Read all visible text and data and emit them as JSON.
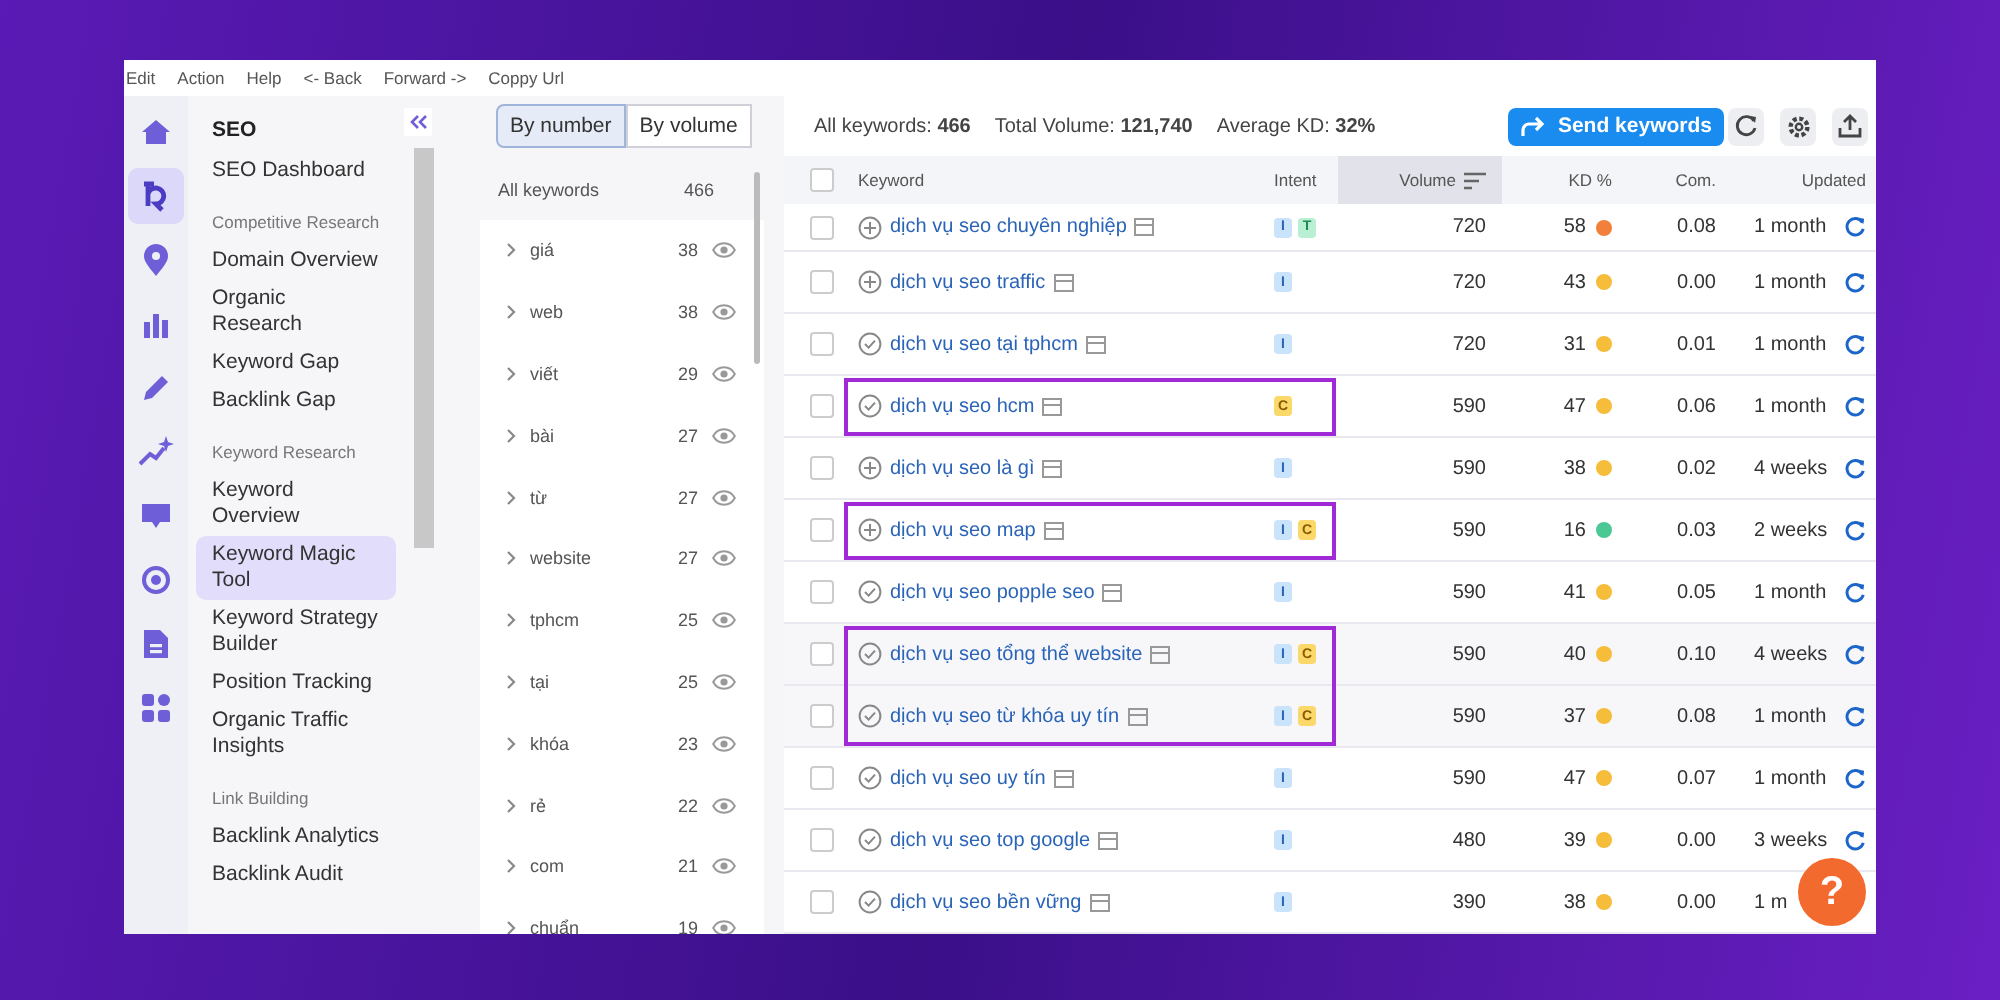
{
  "menu_bar": [
    "Edit",
    "Action",
    "Help",
    "<- Back",
    "Forward ->",
    "Coppy Url"
  ],
  "nav_rail": [
    {
      "selected": false
    },
    {
      "selected": true
    },
    {
      "selected": false
    },
    {
      "selected": false
    },
    {
      "selected": false
    },
    {
      "selected": false
    },
    {
      "selected": false
    },
    {
      "selected": false
    },
    {
      "selected": false
    },
    {
      "selected": false
    }
  ],
  "sidebar": {
    "title": "SEO",
    "items": [
      {
        "kind": "item",
        "label": "SEO Dashboard",
        "selected": false
      },
      {
        "kind": "section",
        "label": "Competitive Research"
      },
      {
        "kind": "item",
        "label": "Domain Overview",
        "selected": false
      },
      {
        "kind": "item",
        "label": "Organic Research",
        "selected": false
      },
      {
        "kind": "item",
        "label": "Keyword Gap",
        "selected": false
      },
      {
        "kind": "item",
        "label": "Backlink Gap",
        "selected": false
      },
      {
        "kind": "section",
        "label": "Keyword Research"
      },
      {
        "kind": "item",
        "label": "Keyword Overview",
        "selected": false
      },
      {
        "kind": "item",
        "label": "Keyword Magic Tool",
        "selected": true
      },
      {
        "kind": "item",
        "label": "Keyword Strategy Builder",
        "selected": false
      },
      {
        "kind": "item",
        "label": "Position Tracking",
        "selected": false
      },
      {
        "kind": "item",
        "label": "Organic Traffic Insights",
        "selected": false
      },
      {
        "kind": "section",
        "label": "Link Building"
      },
      {
        "kind": "item",
        "label": "Backlink Analytics",
        "selected": false
      },
      {
        "kind": "item",
        "label": "Backlink Audit",
        "selected": false
      }
    ]
  },
  "group_tabs": [
    {
      "label": "By number",
      "selected": true
    },
    {
      "label": "By volume",
      "selected": false
    }
  ],
  "groups": {
    "all_label": "All keywords",
    "all_count": "466",
    "items": [
      {
        "label": "giá",
        "count": "38"
      },
      {
        "label": "web",
        "count": "38"
      },
      {
        "label": "viết",
        "count": "29"
      },
      {
        "label": "bài",
        "count": "27"
      },
      {
        "label": "từ",
        "count": "27"
      },
      {
        "label": "website",
        "count": "27"
      },
      {
        "label": "tphcm",
        "count": "25"
      },
      {
        "label": "tại",
        "count": "25"
      },
      {
        "label": "khóa",
        "count": "23"
      },
      {
        "label": "rẻ",
        "count": "22"
      },
      {
        "label": "com",
        "count": "21"
      },
      {
        "label": "chuẩn",
        "count": "19"
      }
    ]
  },
  "summary": {
    "all_label": "All keywords:",
    "all_value": "466",
    "volume_label": "Total Volume:",
    "volume_value": "121,740",
    "kd_label": "Average KD:",
    "kd_value": "32%"
  },
  "send_button": "Send keywords",
  "table": {
    "select_all_checked": false,
    "columns": [
      "Keyword",
      "Intent",
      "Volume",
      "KD %",
      "Com.",
      "Updated"
    ],
    "rows": [
      {
        "keyword": "dịch vụ seo chuyên nghiệp",
        "checked": false,
        "added": false,
        "intent": [
          {
            "label": "I",
            "kind": "informational"
          },
          {
            "label": "T",
            "kind": "transactional"
          }
        ],
        "volume": "720",
        "kd": "58",
        "color": "#f2803a",
        "com": "0.08",
        "updated": "1 month",
        "highlighted": false
      },
      {
        "keyword": "dịch vụ seo traffic",
        "checked": false,
        "added": false,
        "intent": [
          {
            "label": "I",
            "kind": "informational"
          }
        ],
        "volume": "720",
        "kd": "43",
        "color": "#f5bd3a",
        "com": "0.00",
        "updated": "1 month",
        "highlighted": false
      },
      {
        "keyword": "dịch vụ seo tại tphcm",
        "checked": false,
        "added": true,
        "intent": [
          {
            "label": "I",
            "kind": "informational"
          }
        ],
        "volume": "720",
        "kd": "31",
        "color": "#f5bd3a",
        "com": "0.01",
        "updated": "1 month",
        "highlighted": false
      },
      {
        "keyword": "dịch vụ seo hcm",
        "checked": false,
        "added": true,
        "intent": [
          {
            "label": "C",
            "kind": "commercial"
          }
        ],
        "volume": "590",
        "kd": "47",
        "color": "#f5bd3a",
        "com": "0.06",
        "updated": "1 month",
        "highlighted": true
      },
      {
        "keyword": "dịch vụ seo là gì",
        "checked": false,
        "added": false,
        "intent": [
          {
            "label": "I",
            "kind": "informational"
          }
        ],
        "volume": "590",
        "kd": "38",
        "color": "#f5bd3a",
        "com": "0.02",
        "updated": "4 weeks",
        "highlighted": false
      },
      {
        "keyword": "dịch vụ seo map",
        "checked": false,
        "added": false,
        "intent": [
          {
            "label": "I",
            "kind": "informational"
          },
          {
            "label": "C",
            "kind": "commercial"
          }
        ],
        "volume": "590",
        "kd": "16",
        "color": "#4cc894",
        "com": "0.03",
        "updated": "2 weeks",
        "highlighted": true
      },
      {
        "keyword": "dịch vụ seo popple seo",
        "checked": false,
        "added": true,
        "intent": [
          {
            "label": "I",
            "kind": "informational"
          }
        ],
        "volume": "590",
        "kd": "41",
        "color": "#f5bd3a",
        "com": "0.05",
        "updated": "1 month",
        "highlighted": false
      },
      {
        "keyword": "dịch vụ seo tổng thể website",
        "checked": false,
        "added": true,
        "intent": [
          {
            "label": "I",
            "kind": "informational"
          },
          {
            "label": "C",
            "kind": "commercial"
          }
        ],
        "volume": "590",
        "kd": "40",
        "color": "#f5bd3a",
        "com": "0.10",
        "updated": "4 weeks",
        "highlighted": true
      },
      {
        "keyword": "dịch vụ seo từ khóa uy tín",
        "checked": false,
        "added": true,
        "intent": [
          {
            "label": "I",
            "kind": "informational"
          },
          {
            "label": "C",
            "kind": "commercial"
          }
        ],
        "volume": "590",
        "kd": "37",
        "color": "#f5bd3a",
        "com": "0.08",
        "updated": "1 month",
        "highlighted": true
      },
      {
        "keyword": "dịch vụ seo uy tín",
        "checked": false,
        "added": true,
        "intent": [
          {
            "label": "I",
            "kind": "informational"
          }
        ],
        "volume": "590",
        "kd": "47",
        "color": "#f5bd3a",
        "com": "0.07",
        "updated": "1 month",
        "highlighted": false
      },
      {
        "keyword": "dịch vụ seo top google",
        "checked": false,
        "added": true,
        "intent": [
          {
            "label": "I",
            "kind": "informational"
          }
        ],
        "volume": "480",
        "kd": "39",
        "color": "#f5bd3a",
        "com": "0.00",
        "updated": "3 weeks",
        "highlighted": false
      },
      {
        "keyword": "dịch vụ seo bền vững",
        "checked": false,
        "added": true,
        "intent": [
          {
            "label": "I",
            "kind": "informational"
          }
        ],
        "volume": "390",
        "kd": "38",
        "color": "#f5bd3a",
        "com": "0.00",
        "updated": "1 m",
        "refresh_shown": false,
        "highlighted": false
      }
    ]
  },
  "help_button": "?"
}
